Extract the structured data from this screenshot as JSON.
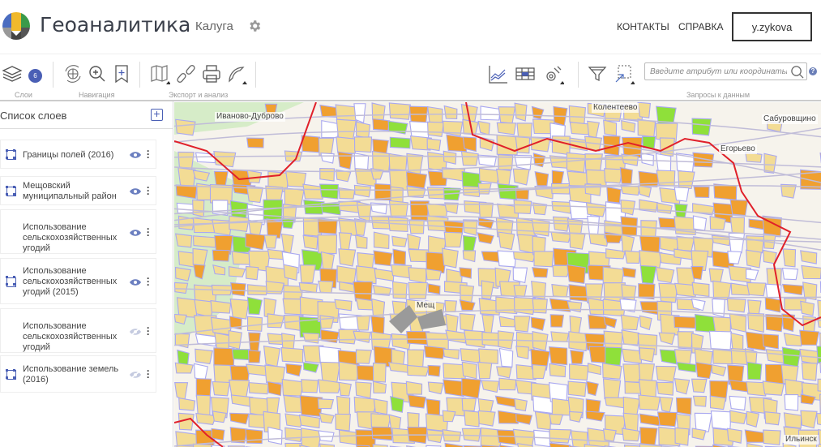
{
  "header": {
    "app_title": "Геоаналитика",
    "city": "Калуга",
    "nav": [
      "КОНТАКТЫ",
      "СПРАВКА"
    ],
    "user": "y.zykova"
  },
  "toolbar": {
    "layers_count": "6",
    "groups": {
      "layers": "Слои",
      "navigation": "Навигация",
      "export": "Экспорт и анализ",
      "queries": "Запросы к данным"
    },
    "search_placeholder": "Введите атрибут или координаты",
    "help": "?"
  },
  "sidebar": {
    "title": "Список слоев",
    "add": "+",
    "layers": [
      {
        "name": "Границы полей (2016)",
        "visible": true,
        "has_geometry_icon": true
      },
      {
        "name": "Мещовский муниципальный район",
        "visible": true,
        "has_geometry_icon": true
      },
      {
        "name": "Использование сельскохозяйственных угодий",
        "visible": true,
        "has_geometry_icon": false
      },
      {
        "name": "Использование сельскохозяйственных угодий (2015)",
        "visible": true,
        "has_geometry_icon": true
      },
      {
        "name": "Использование сельскохозяйственных угодий",
        "visible": false,
        "has_geometry_icon": false
      },
      {
        "name": "Использование земель (2016)",
        "visible": false,
        "has_geometry_icon": true
      }
    ]
  },
  "map": {
    "labels": [
      "Иваново-Дуброво",
      "Колентеево",
      "Сабуровщино",
      "Егорьево",
      "Мещ",
      "Ильинск"
    ],
    "colors": {
      "field": "#f3dc95",
      "orange": "#f0a030",
      "green": "#8fe03a",
      "boundary": "#e0202a",
      "lines": "#a9a8f0",
      "forest": "#d6ecc8"
    }
  }
}
